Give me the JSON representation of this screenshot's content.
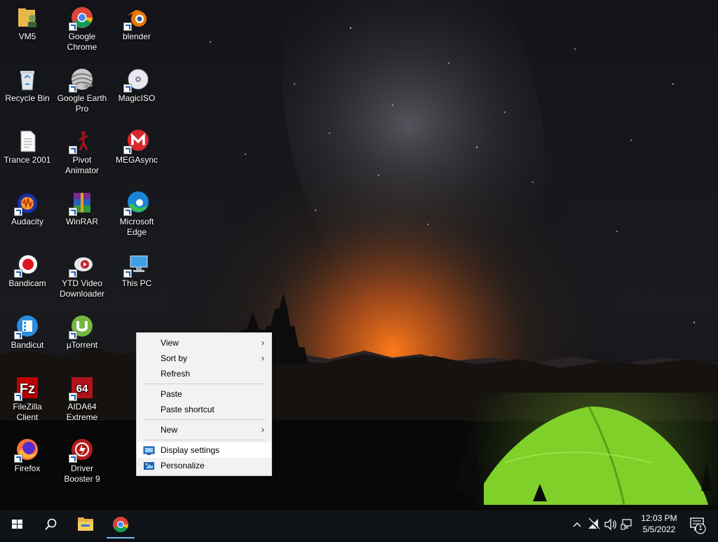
{
  "desktop": {
    "icons": [
      {
        "label": "VM5",
        "icon": "folder-user-icon"
      },
      {
        "label": "Google Chrome",
        "icon": "chrome-icon"
      },
      {
        "label": "blender",
        "icon": "blender-icon"
      },
      {
        "label": "Recycle Bin",
        "icon": "recycle-bin-icon"
      },
      {
        "label": "Google Earth Pro",
        "icon": "google-earth-icon"
      },
      {
        "label": "MagicISO",
        "icon": "disc-icon"
      },
      {
        "label": "Trance 2001",
        "icon": "document-icon"
      },
      {
        "label": "Pivot Animator",
        "icon": "stickman-icon"
      },
      {
        "label": "MEGAsync",
        "icon": "mega-icon"
      },
      {
        "label": "Audacity",
        "icon": "audacity-icon"
      },
      {
        "label": "WinRAR",
        "icon": "winrar-icon"
      },
      {
        "label": "Microsoft Edge",
        "icon": "edge-icon"
      },
      {
        "label": "Bandicam",
        "icon": "bandicam-icon"
      },
      {
        "label": "YTD Video Downloader",
        "icon": "ytd-icon"
      },
      {
        "label": "This PC",
        "icon": "computer-icon"
      },
      {
        "label": "Bandicut",
        "icon": "bandicut-icon"
      },
      {
        "label": "µTorrent",
        "icon": "utorrent-icon"
      },
      {
        "label": "FileZilla Client",
        "icon": "filezilla-icon"
      },
      {
        "label": "AIDA64 Extreme",
        "icon": "aida64-icon"
      },
      {
        "label": "Firefox",
        "icon": "firefox-icon"
      },
      {
        "label": "Driver Booster 9",
        "icon": "driver-booster-icon"
      }
    ]
  },
  "context_menu": {
    "items": [
      {
        "label": "View",
        "has_submenu": true
      },
      {
        "label": "Sort by",
        "has_submenu": true
      },
      {
        "label": "Refresh"
      },
      {
        "label": "Paste"
      },
      {
        "label": "Paste shortcut"
      },
      {
        "label": "New",
        "has_submenu": true
      },
      {
        "label": "Display settings",
        "icon": "display-icon",
        "highlighted": true
      },
      {
        "label": "Personalize",
        "icon": "personalize-icon"
      }
    ],
    "submenu_arrow": "›"
  },
  "taskbar": {
    "start_icon": "windows-logo-icon",
    "search_icon": "search-icon",
    "pinned": [
      {
        "name": "File Explorer",
        "icon": "file-explorer-icon"
      },
      {
        "name": "Google Chrome",
        "icon": "chrome-icon",
        "active": true
      }
    ],
    "tray": {
      "chevron": "^",
      "icons": [
        "network-disconnected-icon",
        "volume-icon",
        "display-projection-icon"
      ],
      "time": "12:03 PM",
      "date": "5/5/2022",
      "notification_count": "1"
    }
  },
  "colors": {
    "accent": "#76b9ed",
    "taskbar": "#101418",
    "menu_bg": "#f2f2f2",
    "tent": "#7fd12a"
  }
}
